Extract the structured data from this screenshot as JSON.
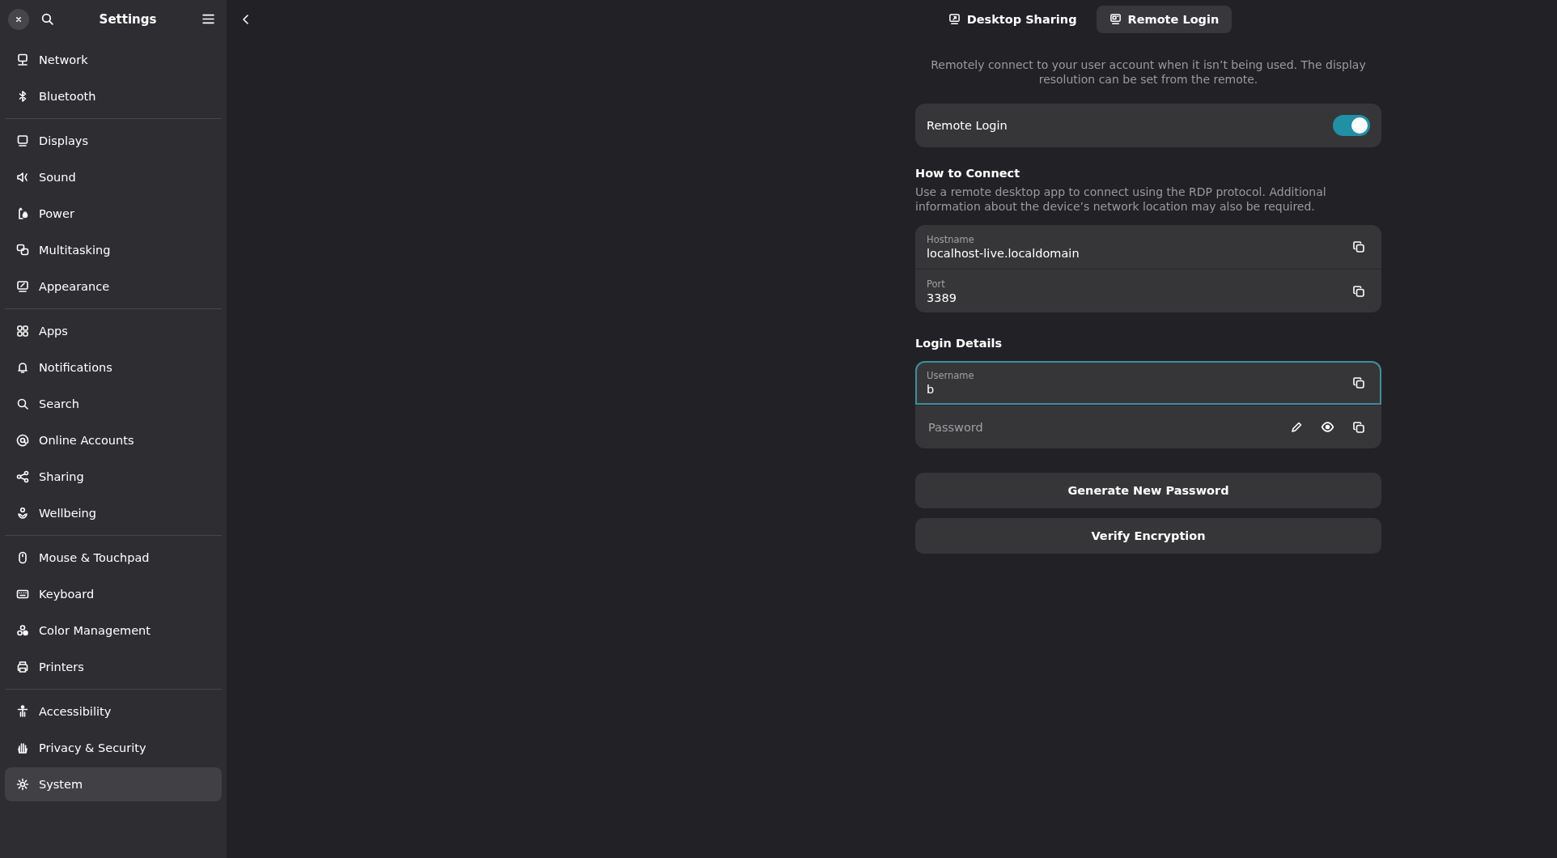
{
  "window": {
    "title": "Settings"
  },
  "sidebar": {
    "sections": [
      {
        "items": [
          {
            "label": "Network",
            "selected": false
          },
          {
            "label": "Bluetooth",
            "selected": false
          }
        ]
      },
      {
        "items": [
          {
            "label": "Displays",
            "selected": false
          },
          {
            "label": "Sound",
            "selected": false
          },
          {
            "label": "Power",
            "selected": false
          },
          {
            "label": "Multitasking",
            "selected": false
          },
          {
            "label": "Appearance",
            "selected": false
          }
        ]
      },
      {
        "items": [
          {
            "label": "Apps",
            "selected": false
          },
          {
            "label": "Notifications",
            "selected": false
          },
          {
            "label": "Search",
            "selected": false
          },
          {
            "label": "Online Accounts",
            "selected": false
          },
          {
            "label": "Sharing",
            "selected": false
          },
          {
            "label": "Wellbeing",
            "selected": false
          }
        ]
      },
      {
        "items": [
          {
            "label": "Mouse & Touchpad",
            "selected": false
          },
          {
            "label": "Keyboard",
            "selected": false
          },
          {
            "label": "Color Management",
            "selected": false
          },
          {
            "label": "Printers",
            "selected": false
          }
        ]
      },
      {
        "items": [
          {
            "label": "Accessibility",
            "selected": false
          },
          {
            "label": "Privacy & Security",
            "selected": false
          },
          {
            "label": "System",
            "selected": true
          }
        ]
      }
    ]
  },
  "tabs": [
    {
      "label": "Desktop Sharing",
      "selected": false
    },
    {
      "label": "Remote Login",
      "selected": true
    }
  ],
  "description": "Remotely connect to your user account when it isn’t being used. The display resolution can be set from the remote.",
  "remote_login": {
    "label": "Remote Login",
    "on": true
  },
  "how_to_connect": {
    "heading": "How to Connect",
    "description": "Use a remote desktop app to connect using the RDP protocol. Additional information about the device’s network location may also be required.",
    "fields": [
      {
        "label": "Hostname",
        "value": "localhost-live.localdomain"
      },
      {
        "label": "Port",
        "value": "3389"
      }
    ]
  },
  "login_details": {
    "heading": "Login Details",
    "fields": [
      {
        "kind": "entry",
        "label": "Username",
        "value": "b",
        "focused": true
      },
      {
        "kind": "password",
        "placeholder": "Password",
        "focused": false
      }
    ]
  },
  "buttons": [
    "Generate New Password",
    "Verify Encryption"
  ]
}
